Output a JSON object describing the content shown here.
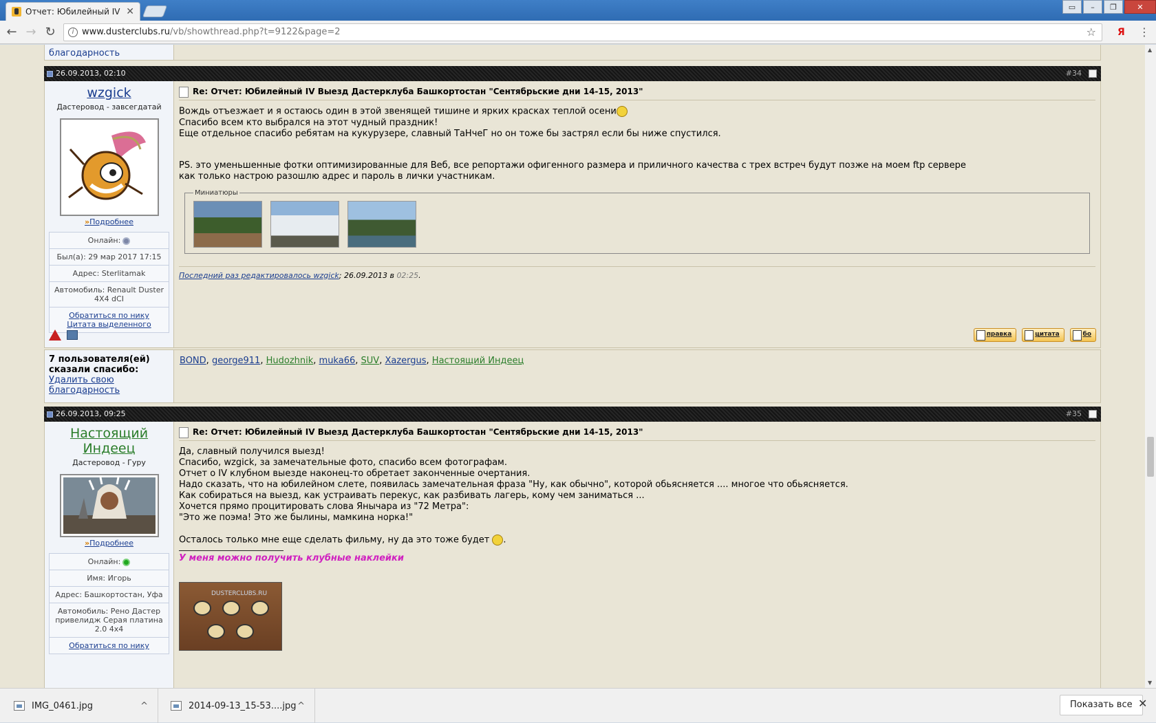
{
  "browser": {
    "tab_title": "Отчет: Юбилейный IV В",
    "tab_close": "✕",
    "url_domain": "www.dusterclubs.ru",
    "url_path": "/vb/showthread.php?t=9122&page=2",
    "window_controls": [
      "▭",
      "–",
      "❐",
      "✕"
    ],
    "nav_back": "←",
    "nav_forward": "→",
    "nav_reload": "↻",
    "star": "☆",
    "extension": "Я",
    "menu": "⋮"
  },
  "top_cut": {
    "link": "благодарность"
  },
  "post34": {
    "date": "26.09.2013, 02:10",
    "num_prefix": "#",
    "num": "34",
    "username": "wzgick",
    "usertitle": "Дастеровод - завсегдатай",
    "more": "Подробнее",
    "online_label": "Онлайн:",
    "last_seen": "Был(а): 29 мар 2017 17:15",
    "address": "Адрес: Sterlitamak",
    "car": "Автомобиль: Renault Duster 4X4 dCI",
    "link_nick": "Обратиться по нику",
    "link_quote": "Цитата выделенного",
    "title": "Re: Отчет: Юбилейный IV Выезд Дастерклуба Башкортостан \"Сентябрьские дни 14-15, 2013\"",
    "line1": "Вождь отъезжает и я остаюсь один в этой звенящей тишине и ярких красках теплой осени",
    "line2": "Спасибо всем кто выбрался на этот чудный праздник!",
    "line3": "Еще отдельное спасибо ребятам на кукурузере, славный ТаНчеГ но он тоже бы застрял если бы ниже спустился.",
    "line4": "PS. это уменьшенные фотки оптимизированные для Веб, все репортажи офигенного размера и приличного качества с трех встреч будут позже на моем ftp сервере",
    "line5": "как только настрою разошлю адрес и пароль в лички участникам.",
    "thumbs_legend": "Миниатюры",
    "edited_link": "Последний раз редактировалось wzgick",
    "edited_date": "; 26.09.2013 в ",
    "edited_time": "02:25",
    "edited_dot": ".",
    "btn_edit": "правка",
    "btn_quote": "цитата",
    "btn_more": "бо"
  },
  "thanks34": {
    "label": "7 пользователя(ей) сказали спасибо:",
    "remove": "Удалить свою благодарность",
    "users": [
      "BOND",
      "george911",
      "Hudozhnik",
      "muka66",
      "SUV",
      "Xazergus",
      "Настоящий Индеец"
    ],
    "sep": ", "
  },
  "post35": {
    "date": "26.09.2013, 09:25",
    "num_prefix": "#",
    "num": "35",
    "username": "Настоящий Индеец",
    "usertitle": "Дастеровод - Гуру",
    "more": "Подробнее",
    "online_label": "Онлайн:",
    "name": "Имя: Игорь",
    "address": "Адрес: Башкортостан, Уфа",
    "car": "Автомобиль: Рено Дастер привелидж Серая платина 2.0 4x4",
    "link_nick": "Обратиться по нику",
    "title": "Re: Отчет: Юбилейный IV Выезд Дастерклуба Башкортостан \"Сентябрьские дни 14-15, 2013\"",
    "lines": [
      "Да, славный получился выезд!",
      "Спасибо, wzgick, за замечательные фото, спасибо всем фотографам.",
      "Отчет о IV клубном выезде наконец-то обретает законченные очертания.",
      "Надо сказать, что на юбилейном слете, появилась замечательная фраза \"Ну, как обычно\", которой обьясняется .... многое что обьясняется.",
      "Как собираться на выезд, как устраивать перекус, как разбивать лагерь, кому чем заниматься ...",
      "Хочется прямо процитировать слова Янычара из \"72 Метра\":",
      "\"Это же поэма! Это же былины, мамкина норка!\""
    ],
    "film_line": "Осталось только мне еще сделать фильму, ну да это тоже будет ",
    "film_end": ".",
    "promo": "У меня можно получить клубные наклейки",
    "sticker_brand": "DUSTERCLUBS.RU"
  },
  "downloads": {
    "items": [
      "IMG_0461.jpg",
      "2014-09-13_15-53....jpg"
    ],
    "caret": "^",
    "show_all": "Показать все",
    "close": "✕"
  },
  "colors": {
    "accent_link": "#1a3d8f",
    "green_user": "#2a7d2a",
    "promo": "#d021c0",
    "online_green": "#1fa81f",
    "offline_gray": "#7c86a6"
  }
}
